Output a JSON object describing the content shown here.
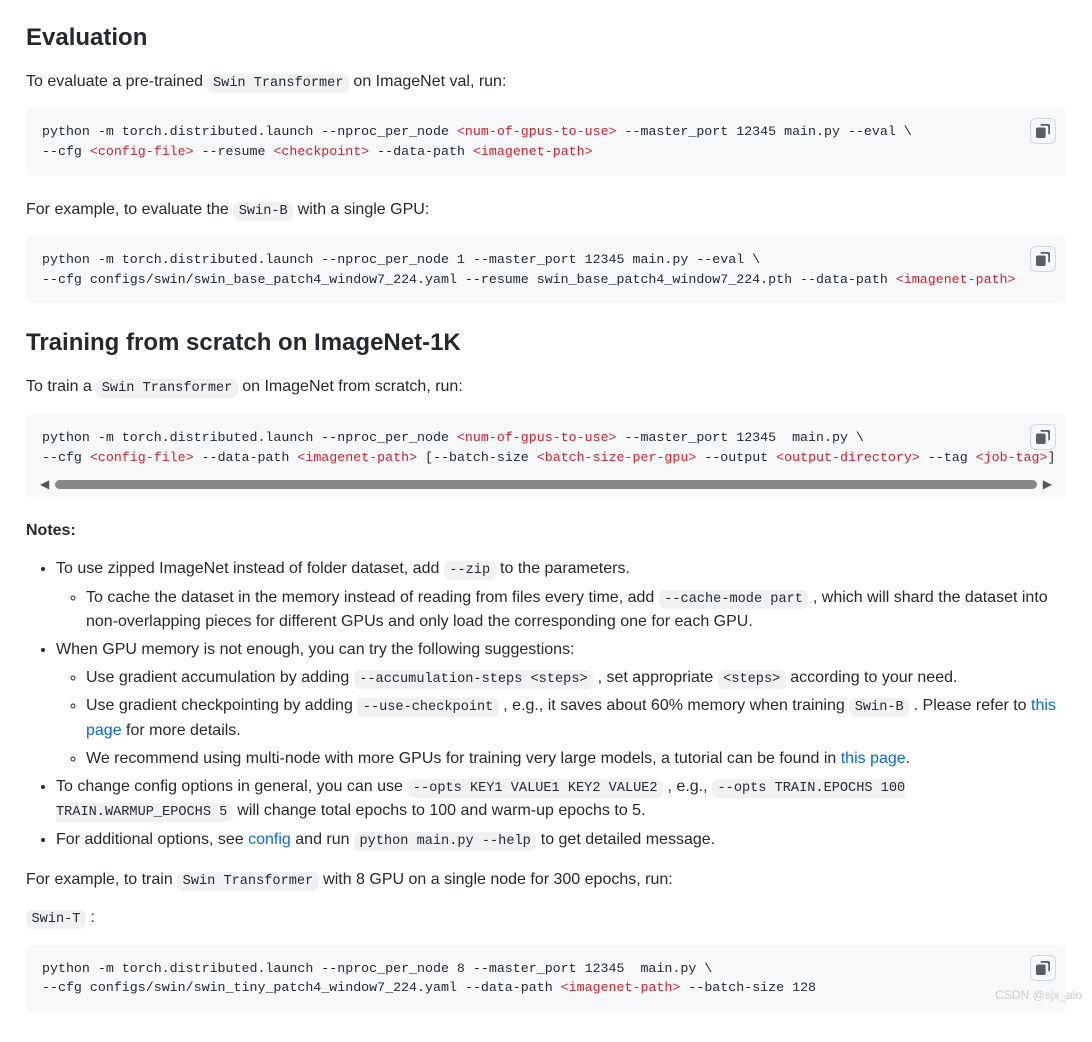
{
  "sec1": {
    "title": "Evaluation",
    "p1a": "To evaluate a pre-trained ",
    "p1code": "Swin Transformer",
    "p1b": " on ImageNet val, run:",
    "code1": {
      "prefix1": "python -m torch.distributed.launch --nproc_per_node ",
      "arg1": "<num-of-gpus-to-use>",
      "mid1": " --master_port 12345 main.py --eval \\\n--cfg ",
      "arg2": "<config-file>",
      "mid2": " --resume ",
      "arg3": "<checkpoint>",
      "mid3": " --data-path ",
      "arg4": "<imagenet-path>"
    },
    "p2a": "For example, to evaluate the ",
    "p2code": "Swin-B",
    "p2b": " with a single GPU:",
    "code2": {
      "line": "python -m torch.distributed.launch --nproc_per_node 1 --master_port 12345 main.py --eval \\\n--cfg configs/swin/swin_base_patch4_window7_224.yaml --resume swin_base_patch4_window7_224.pth --data-path ",
      "arg": "<imagenet-path>"
    }
  },
  "sec2": {
    "title": "Training from scratch on ImageNet-1K",
    "p1a": "To train a ",
    "p1code": "Swin Transformer",
    "p1b": " on ImageNet from scratch, run:",
    "code1": {
      "prefix": "python -m torch.distributed.launch --nproc_per_node ",
      "a1": "<num-of-gpus-to-use>",
      "m1": " --master_port 12345  main.py \\\n--cfg ",
      "a2": "<config-file>",
      "m2": " --data-path ",
      "a3": "<imagenet-path>",
      "m3": " [--batch-size ",
      "a4": "<batch-size-per-gpu>",
      "m4": " --output ",
      "a5": "<output-directory>",
      "m5": " --tag ",
      "a6": "<job-tag>",
      "m6": "]"
    },
    "notesHeader": "Notes:",
    "notes": {
      "n1a": "To use zipped ImageNet instead of folder dataset, add ",
      "n1code": "--zip",
      "n1b": " to the parameters.",
      "n1s1a": "To cache the dataset in the memory instead of reading from files every time, add ",
      "n1s1code": "--cache-mode part",
      "n1s1b": " , which will shard the dataset into non-overlapping pieces for different GPUs and only load the corresponding one for each GPU.",
      "n2": "When GPU memory is not enough, you can try the following suggestions:",
      "n2s1a": "Use gradient accumulation by adding ",
      "n2s1code1": "--accumulation-steps <steps>",
      "n2s1b": " , set appropriate ",
      "n2s1code2": "<steps>",
      "n2s1c": " according to your need.",
      "n2s2a": "Use gradient checkpointing by adding ",
      "n2s2code": "--use-checkpoint",
      "n2s2b": " , e.g., it saves about 60% memory when training ",
      "n2s2code2": "Swin-B",
      "n2s2c": " . Please refer to ",
      "n2s2link": "this page",
      "n2s2d": " for more details.",
      "n2s3a": "We recommend using multi-node with more GPUs for training very large models, a tutorial can be found in ",
      "n2s3link": "this page",
      "n2s3b": ".",
      "n3a": "To change config options in general, you can use ",
      "n3code1": "--opts KEY1 VALUE1 KEY2 VALUE2",
      "n3b": " , e.g., ",
      "n3code2": "--opts TRAIN.EPOCHS 100 TRAIN.WARMUP_EPOCHS 5",
      "n3c": " will change total epochs to 100 and warm-up epochs to 5.",
      "n4a": "For additional options, see ",
      "n4link": "config",
      "n4b": " and run ",
      "n4code": "python main.py --help",
      "n4c": " to get detailed message."
    },
    "p3a": "For example, to train ",
    "p3code": "Swin Transformer",
    "p3b": " with 8 GPU on a single node for 300 epochs, run:",
    "model": "Swin-T",
    "colon": " :",
    "code2": {
      "l1": "python -m torch.distributed.launch --nproc_per_node 8 --master_port 12345  main.py \\\n--cfg configs/swin/swin_tiny_patch4_window7_224.yaml --data-path ",
      "a1": "<imagenet-path>",
      "l2": " --batch-size 128"
    }
  },
  "watermark": "CSDN @sjx_alo"
}
